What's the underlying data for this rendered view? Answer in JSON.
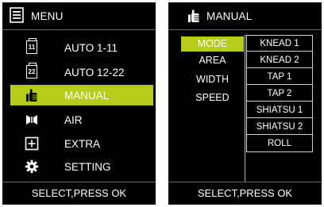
{
  "left_panel": {
    "header_title": "MENU",
    "items": [
      {
        "label": "AUTO 1-11",
        "icon": "program-11-icon",
        "icon_text": "11",
        "active": false
      },
      {
        "label": "AUTO 12-22",
        "icon": "program-22-icon",
        "icon_text": "22",
        "active": false
      },
      {
        "label": "MANUAL",
        "icon": "hand-icon",
        "active": true
      },
      {
        "label": "AIR",
        "icon": "air-pressure-icon",
        "active": false
      },
      {
        "label": "EXTRA",
        "icon": "plus-box-icon",
        "active": false
      },
      {
        "label": "SETTING",
        "icon": "gear-icon",
        "active": false
      }
    ],
    "footer": "SELECT,PRESS OK"
  },
  "right_panel": {
    "header_title": "MANUAL",
    "categories": [
      "MODE",
      "AREA",
      "WIDTH",
      "SPEED"
    ],
    "active_category": "MODE",
    "options": [
      "KNEAD 1",
      "KNEAD 2",
      "TAP 1",
      "TAP 2",
      "SHIATSU 1",
      "SHIATSU 2",
      "ROLL"
    ],
    "footer": "SELECT,PRESS OK"
  },
  "colors": {
    "background": "#000000",
    "highlight": "#b5cc1a",
    "text": "#ffffff"
  }
}
